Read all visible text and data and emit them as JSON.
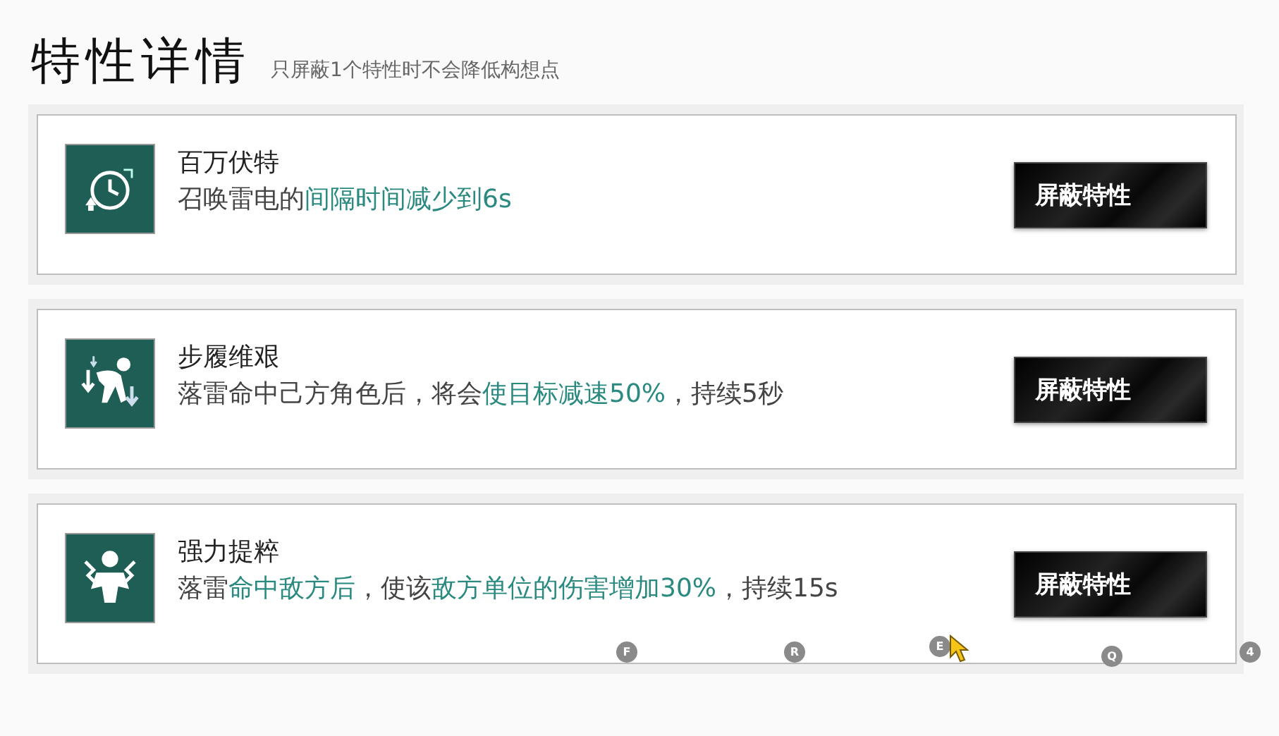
{
  "header": {
    "title": "特性详情",
    "subtitle": "只屏蔽1个特性时不会降低构想点"
  },
  "traits": [
    {
      "kind": "stopwatch",
      "name": "百万伏特",
      "description": [
        {
          "text": "召唤雷电的",
          "highlight": false
        },
        {
          "text": "间隔时间减少到6s",
          "highlight": true
        }
      ],
      "button": "屏蔽特性"
    },
    {
      "kind": "slowed",
      "name": "步履维艰",
      "description": [
        {
          "text": "落雷命中己方角色后，将会",
          "highlight": false
        },
        {
          "text": "使目标减速50%",
          "highlight": true
        },
        {
          "text": "，持续5秒",
          "highlight": false
        }
      ],
      "button": "屏蔽特性"
    },
    {
      "kind": "damage",
      "name": "强力提粹",
      "description": [
        {
          "text": "落雷",
          "highlight": false
        },
        {
          "text": "命中敌方后",
          "highlight": true
        },
        {
          "text": "，使该",
          "highlight": false
        },
        {
          "text": "敌方单位的伤害增加30%",
          "highlight": true
        },
        {
          "text": "，持续15s",
          "highlight": false
        }
      ],
      "button": "屏蔽特性"
    }
  ],
  "key_hints": [
    "F",
    "R",
    "E",
    "Q",
    "4"
  ]
}
